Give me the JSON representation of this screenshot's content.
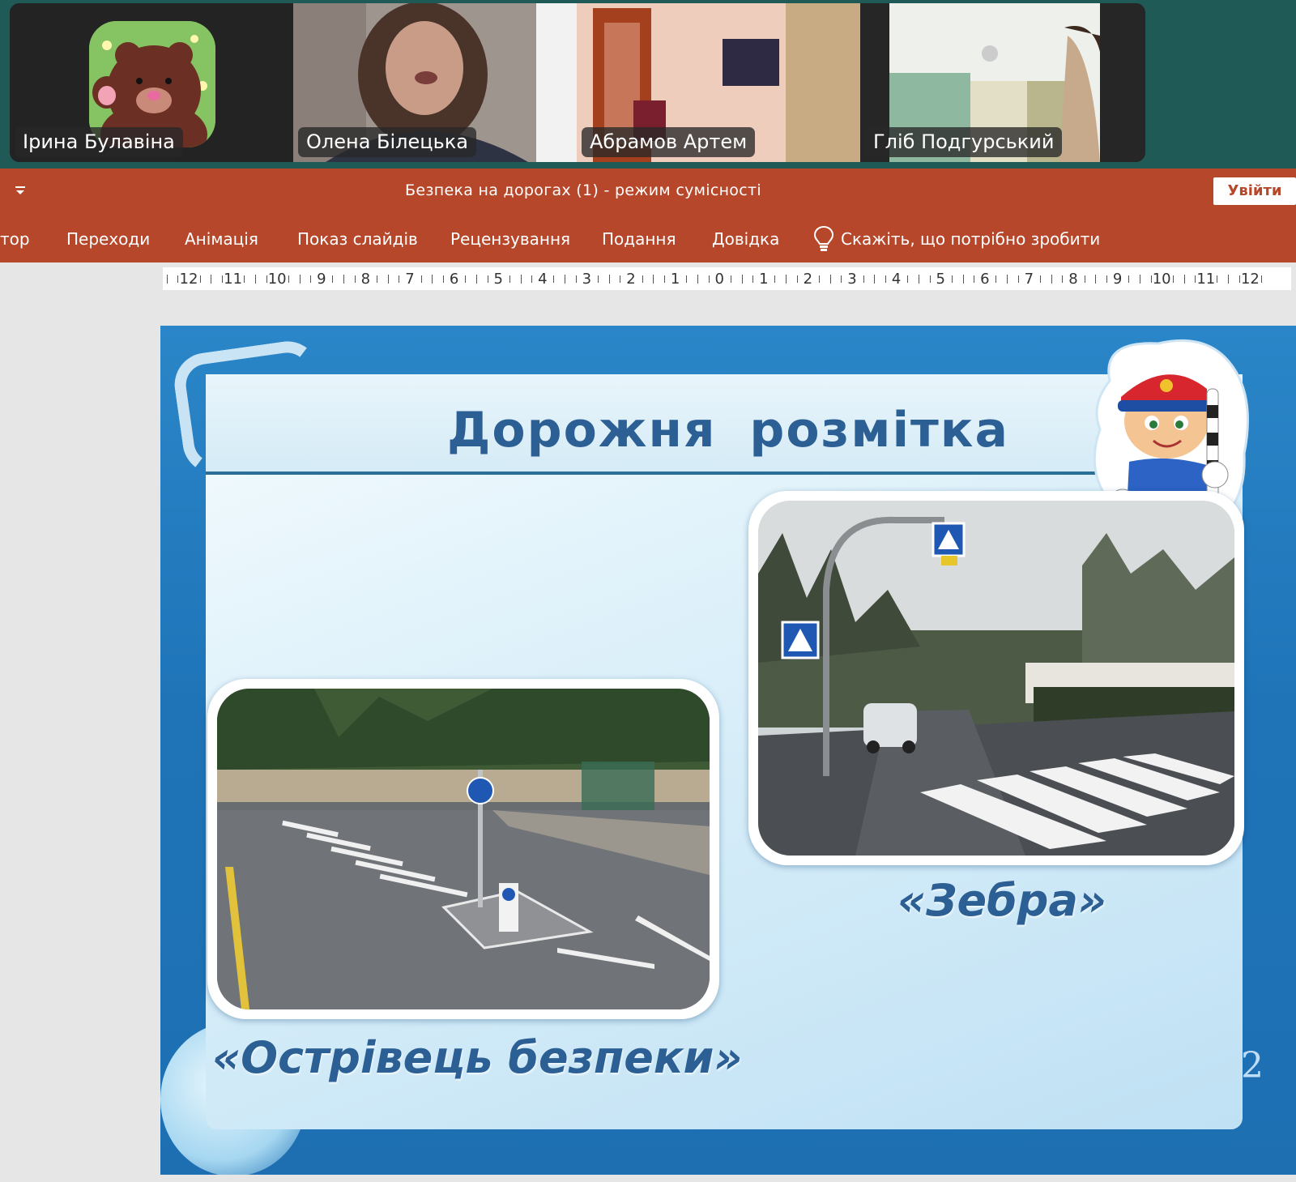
{
  "video": {
    "participants": [
      {
        "name": "Ірина Булавіна",
        "active": false
      },
      {
        "name": "Олена Білецька",
        "active": true
      },
      {
        "name": "Абрамов Артем",
        "active": false
      },
      {
        "name": "Гліб Подгурський",
        "active": false
      }
    ],
    "active_border_color": "#2de08d"
  },
  "powerpoint": {
    "qat_icon": "customize-quick-access-chevron",
    "document_title": "Безпека на дорогах (1)  -  режим сумісності",
    "signin_label": "Увійти",
    "tabs": [
      "тор",
      "Переходи",
      "Анімація",
      "Показ слайдів",
      "Рецензування",
      "Подання",
      "Довідка"
    ],
    "tell_me": "Скажіть, що потрібно зробити",
    "accent_color": "#b7472a"
  },
  "ruler": {
    "labels": [
      "12",
      "11",
      "10",
      "9",
      "8",
      "7",
      "6",
      "5",
      "4",
      "3",
      "2",
      "1",
      "0",
      "1",
      "2",
      "3",
      "4",
      "5",
      "6",
      "7",
      "8",
      "9",
      "10",
      "11",
      "12"
    ]
  },
  "slide": {
    "title": "Дорожня  розмітка",
    "caption_zebra": "«Зебра»",
    "caption_island": "«Острівець безпеки»",
    "page_number": "2",
    "title_color": "#2c5f94"
  }
}
